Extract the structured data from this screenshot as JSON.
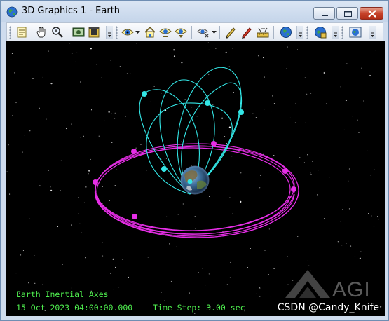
{
  "window": {
    "title": "3D Graphics 1 - Earth",
    "icon": "globe-icon"
  },
  "title_buttons": [
    "minimize",
    "maximize",
    "close"
  ],
  "toolbar": {
    "groups": [
      {
        "items": [
          "notes-icon",
          "pan-hand-icon",
          "zoom-icon",
          "snapshot-icon",
          "record-movie-icon"
        ]
      },
      {
        "items": [
          "view-from-to-icon",
          "home-view-icon",
          "orient-north-icon",
          "orient-top-icon"
        ]
      },
      {
        "items": [
          "properties-icon",
          "pen-icon",
          "pen-red-icon",
          "measure-ruler-icon"
        ]
      },
      {
        "items": [
          "globe-manager-icon"
        ]
      },
      {
        "items": [
          "globe-terrain-icon"
        ]
      },
      {
        "items": [
          "window-globe-icon"
        ]
      }
    ]
  },
  "viewport": {
    "frame_label": "Earth Inertial Axes",
    "datetime": "15 Oct 2023 04:00:00.000",
    "time_step": "Time Step: 3.00 sec",
    "logo_text": "AGI",
    "watermark": "CSDN @Candy_Knife",
    "colors": {
      "background": "#000000",
      "molniya_orbits": "#33e6e6",
      "equatorial_orbits": "#e62ee6",
      "overlay_text": "#4ff04f"
    }
  }
}
